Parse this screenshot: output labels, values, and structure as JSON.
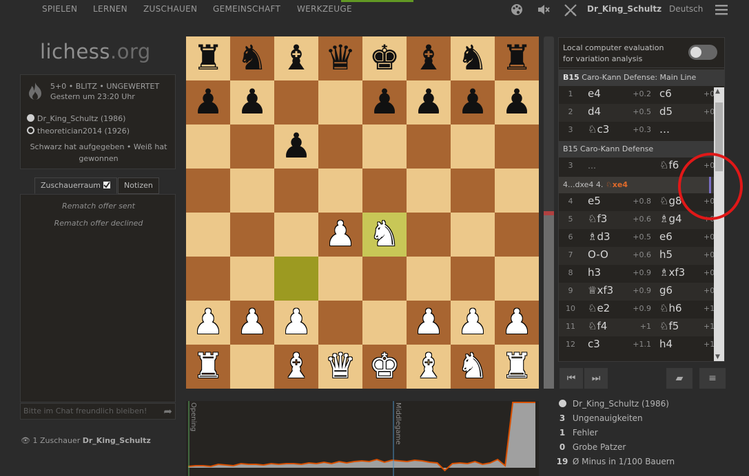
{
  "nav": {
    "items": [
      "SPIELEN",
      "LERNEN",
      "ZUSCHAUEN",
      "GEMEINSCHAFT",
      "WERKZEUGE"
    ],
    "icons": [
      "palette-icon",
      "mute-icon",
      "crossed-swords-icon"
    ],
    "username": "Dr_King_Schultz",
    "language": "Deutsch"
  },
  "logo": {
    "main": "lichess",
    "tld": ".org"
  },
  "game": {
    "line1": "5+0 • BLITZ • UNGEWERTET",
    "line2": "Gestern um 23:20 Uhr",
    "white_player": "Dr_King_Schultz (1986)",
    "black_player": "theoretician2014 (1926)",
    "status": "Schwarz hat aufgegeben • Weiß hat gewonnen"
  },
  "chat": {
    "tab_chat": "Zuschauerraum",
    "tab_notes": "Notizen",
    "messages": [
      "Rematch offer sent",
      "Rematch offer declined"
    ],
    "placeholder": "Bitte im Chat freundlich bleiben!"
  },
  "spectators": {
    "text": "1 Zuschauer",
    "name": "Dr_King_Schultz"
  },
  "board": {
    "orientation": "white",
    "last_move": [
      "c3",
      "e4"
    ],
    "pieces": {
      "a8": "bR",
      "b8": "bN",
      "c8": "bB",
      "d8": "bQ",
      "e8": "bK",
      "f8": "bB",
      "g8": "bN",
      "h8": "bR",
      "a7": "bP",
      "b7": "bP",
      "e7": "bP",
      "f7": "bP",
      "g7": "bP",
      "h7": "bP",
      "c6": "bP",
      "d4": "wP",
      "e4": "wN",
      "a2": "wP",
      "b2": "wP",
      "c2": "wP",
      "f2": "wP",
      "g2": "wP",
      "h2": "wP",
      "a1": "wR",
      "c1": "wB",
      "d1": "wQ",
      "e1": "wK",
      "f1": "wB",
      "g1": "wN",
      "h1": "wR"
    }
  },
  "analysis": {
    "ceval_label_1": "Local computer evaluation",
    "ceval_label_2": "for variation analysis",
    "opening1": {
      "code": "B15",
      "name": "Caro-Kann Defense: Main Line"
    },
    "opening2": {
      "code": "B15",
      "name": "Caro-Kann Defense"
    },
    "moves_a": [
      {
        "no": "1",
        "w": "e4",
        "ew": "+0.2",
        "b": "c6",
        "eb": "+0"
      },
      {
        "no": "2",
        "w": "d4",
        "ew": "+0.5",
        "b": "d5",
        "eb": "+0"
      },
      {
        "no": "3",
        "w": "♘c3",
        "ew": "+0.3",
        "b": "…",
        "eb": ""
      }
    ],
    "move_3b": {
      "no": "3",
      "w": "…",
      "ew": "",
      "b": "♘f6",
      "eb": "+0"
    },
    "variation": {
      "prefix": "4...dxe4  4.",
      "current": "♘xe4"
    },
    "moves_b": [
      {
        "no": "4",
        "w": "e5",
        "ew": "+0.8",
        "b": "♘g8",
        "eb": "+0"
      },
      {
        "no": "5",
        "w": "♘f3",
        "ew": "+0.6",
        "b": "♗g4",
        "eb": "+0"
      },
      {
        "no": "6",
        "w": "♗d3",
        "ew": "+0.5",
        "b": "e6",
        "eb": "+0"
      },
      {
        "no": "7",
        "w": "O-O",
        "ew": "+0.6",
        "b": "h5",
        "eb": "+0"
      },
      {
        "no": "8",
        "w": "h3",
        "ew": "+0.9",
        "b": "♗xf3",
        "eb": "+0"
      },
      {
        "no": "9",
        "w": "♕xf3",
        "ew": "+0.9",
        "b": "g6",
        "eb": "+0"
      },
      {
        "no": "10",
        "w": "♘e2",
        "ew": "+0.9",
        "b": "♘h6",
        "eb": "+1"
      },
      {
        "no": "11",
        "w": "♘f4",
        "ew": "+1",
        "b": "♘f5",
        "eb": "+1"
      },
      {
        "no": "12",
        "w": "c3",
        "ew": "+1.1",
        "b": "h4",
        "eb": "+1"
      }
    ]
  },
  "graph": {
    "phase1": "Opening",
    "phase2": "Middlegame",
    "advantage": [
      0.2,
      0.3,
      0.3,
      0.2,
      0.5,
      0.4,
      0.3,
      0.6,
      0.5,
      0.5,
      0.4,
      0.6,
      0.5,
      0.6,
      0.6,
      0.5,
      0.7,
      0.6,
      0.8,
      0.6,
      0.9,
      0.7,
      0.9,
      1.0,
      0.9,
      1.2,
      0.8,
      1.1,
      1.0,
      0.9,
      1.1,
      1.0,
      0.8,
      0.7,
      -0.4,
      0.6,
      0.7,
      0.6,
      0.9,
      0.5,
      0.7,
      1.2,
      0.3,
      9.5,
      9.5,
      9.5,
      9.5
    ]
  },
  "summary": {
    "player": "Dr_King_Schultz (1986)",
    "rows": [
      {
        "n": "3",
        "label": "Ungenauigkeiten"
      },
      {
        "n": "1",
        "label": "Fehler"
      },
      {
        "n": "0",
        "label": "Grobe Patzer"
      },
      {
        "n": "19",
        "label": "Ø Minus in 1/100 Bauern"
      }
    ]
  },
  "colors": {
    "light_square": "#ecc88a",
    "dark_square": "#a86531",
    "last_move_light": "#c8c757",
    "last_move_dark": "#9c9a21",
    "highlight_circle": "#e01818",
    "graph_line": "#d85000",
    "graph_fill": "#a0a0a0",
    "phase_opening": "#5fb15f",
    "phase_middlegame": "#4a90c4"
  }
}
